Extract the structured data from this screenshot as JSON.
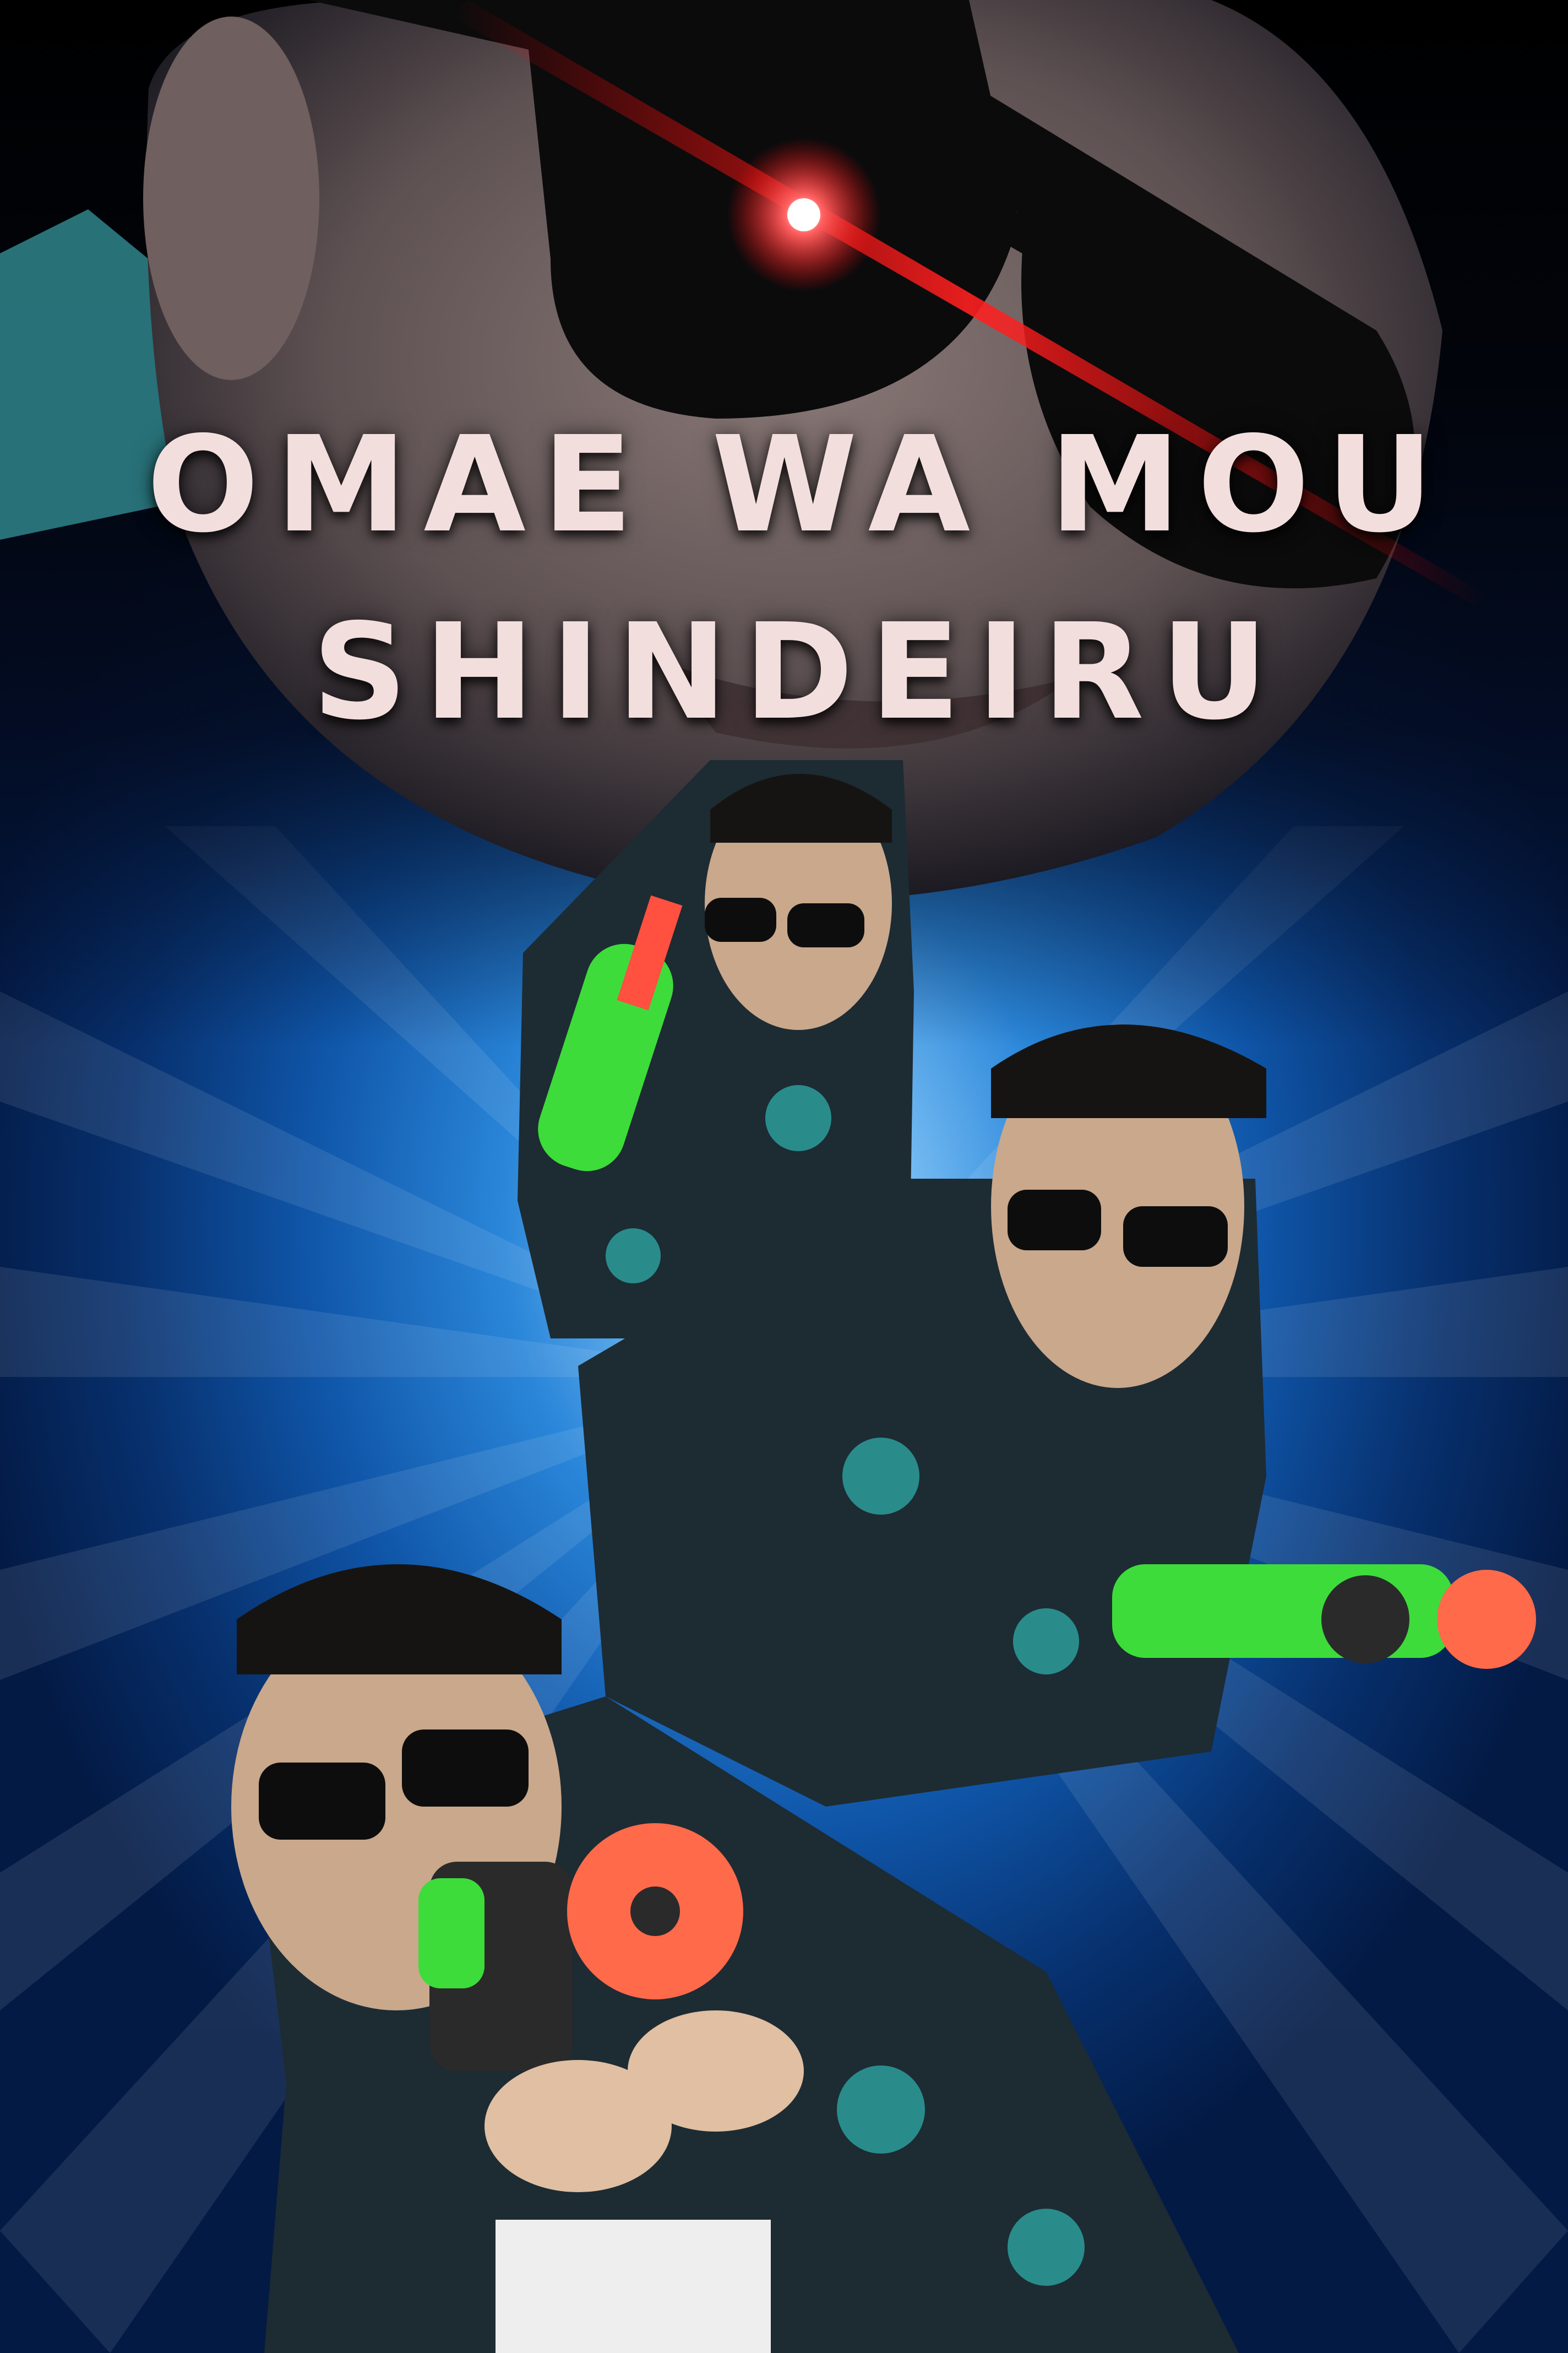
{
  "title": {
    "line1": "OMAE WA MOU",
    "line2": "SHINDEIRU"
  },
  "colors": {
    "title_text": "#f3dede",
    "laser": "#ff1a1a",
    "background_blue": "#1565c0",
    "shirt": "#1d2b33",
    "shirt_pattern": "#2fb7b0",
    "toy_gun_green": "#3ddc3a",
    "toy_gun_orange": "#ff6a4a"
  },
  "icons": [
    "sunglasses-icon",
    "laser-glint-icon",
    "toy-water-gun-icon"
  ]
}
